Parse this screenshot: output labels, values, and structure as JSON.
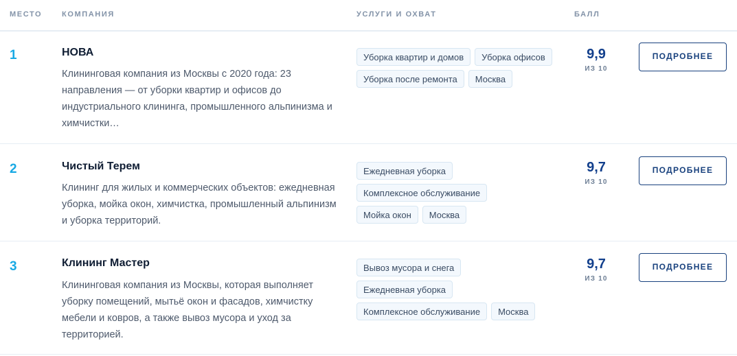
{
  "header": {
    "rank": "МЕСТО",
    "company": "КОМПАНИЯ",
    "services": "УСЛУГИ И ОХВАТ",
    "score": "БАЛЛ"
  },
  "rows": [
    {
      "rank": "1",
      "name": "НОВА",
      "description": "Клининговая компания из Москвы с 2020 года: 23 направления — от уборки квартир и офисов до индустриального клининга, промышленного альпинизма и химчистки…",
      "tags": [
        "Уборка квартир и домов",
        "Уборка офисов",
        "Уборка после ремонта",
        "Москва"
      ],
      "score": "9,9",
      "score_of": "ИЗ 10",
      "button": "ПОДРОБНЕЕ"
    },
    {
      "rank": "2",
      "name": "Чистый Терем",
      "description": "Клининг для жилых и коммерческих объектов: ежедневная уборка, мойка окон, химчистка, промышленный альпинизм и уборка территорий.",
      "tags": [
        "Ежедневная уборка",
        "Комплексное обслуживание",
        "Мойка окон",
        "Москва"
      ],
      "score": "9,7",
      "score_of": "ИЗ 10",
      "button": "ПОДРОБНЕЕ"
    },
    {
      "rank": "3",
      "name": "Клининг Мастер",
      "description": "Клининговая компания из Москвы, которая выполняет уборку помещений, мытьё окон и фасадов, химчистку мебели и ковров, а также вывоз мусора и уход за территорией.",
      "tags": [
        "Вывоз мусора и снега",
        "Ежедневная уборка",
        "Комплексное обслуживание",
        "Москва"
      ],
      "score": "9,7",
      "score_of": "ИЗ 10",
      "button": "ПОДРОБНЕЕ"
    }
  ]
}
